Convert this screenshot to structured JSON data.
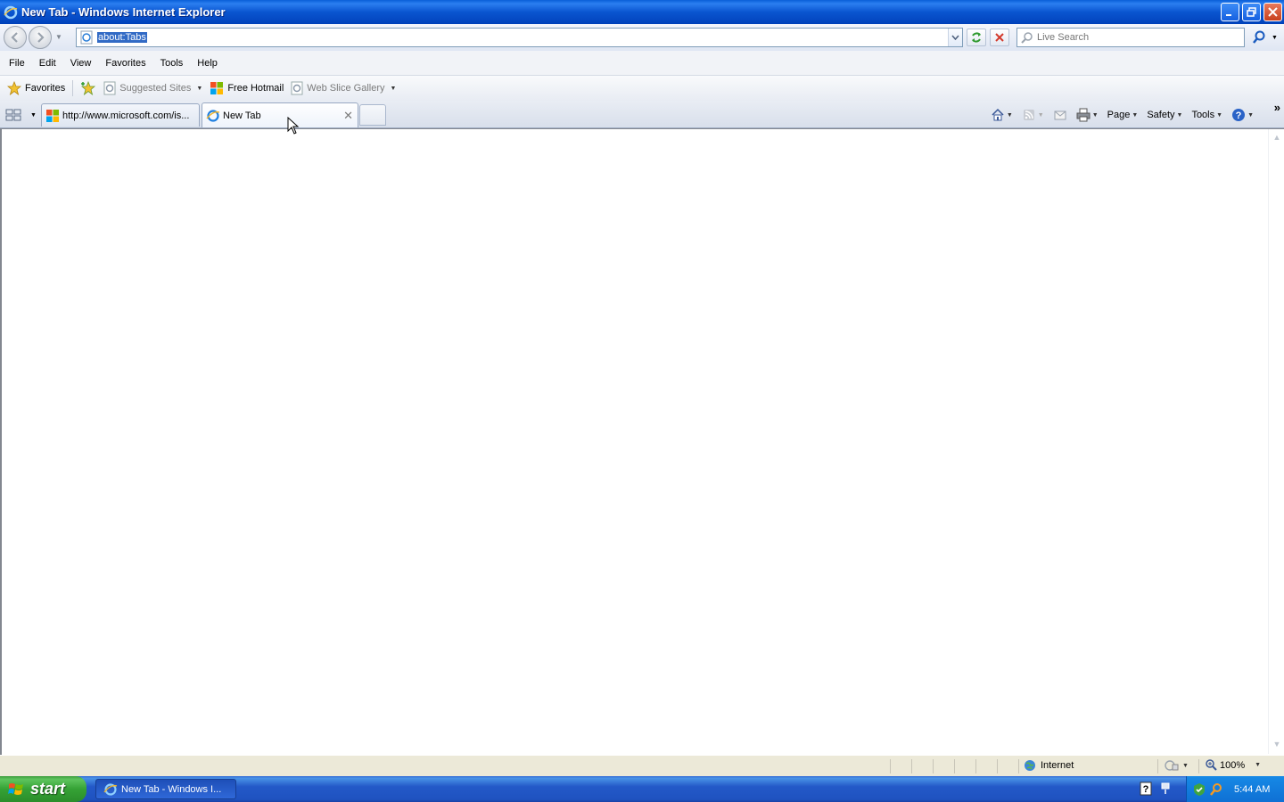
{
  "window": {
    "title": "New Tab - Windows Internet Explorer"
  },
  "address_bar": {
    "url": "about:Tabs"
  },
  "search": {
    "placeholder": "Live Search"
  },
  "menu": {
    "items": [
      "File",
      "Edit",
      "View",
      "Favorites",
      "Tools",
      "Help"
    ]
  },
  "favorites_bar": {
    "favorites_label": "Favorites",
    "items": [
      {
        "label": "Suggested Sites"
      },
      {
        "label": "Free Hotmail"
      },
      {
        "label": "Web Slice Gallery"
      }
    ]
  },
  "tabs": [
    {
      "label": "http://www.microsoft.com/is...",
      "active": false
    },
    {
      "label": "New Tab",
      "active": true
    }
  ],
  "command_bar": {
    "page_label": "Page",
    "safety_label": "Safety",
    "tools_label": "Tools"
  },
  "status_bar": {
    "zone_label": "Internet",
    "zoom": "100%"
  },
  "taskbar": {
    "start_label": "start",
    "task_label": "New Tab - Windows I...",
    "clock": "5:44 AM"
  },
  "colors": {
    "titlebar_blue": "#0a55d0",
    "selection_blue": "#316ac5",
    "start_green": "#35a235"
  },
  "icons": [
    "ie-icon",
    "minimize-icon",
    "restore-icon",
    "close-icon",
    "back-icon",
    "forward-icon",
    "refresh-icon",
    "stop-icon",
    "search-icon",
    "star-icon",
    "add-favorites-icon",
    "windows-flag-icon",
    "home-icon",
    "rss-icon",
    "read-mail-icon",
    "print-icon",
    "help-icon",
    "globe-icon",
    "zoom-icon"
  ]
}
